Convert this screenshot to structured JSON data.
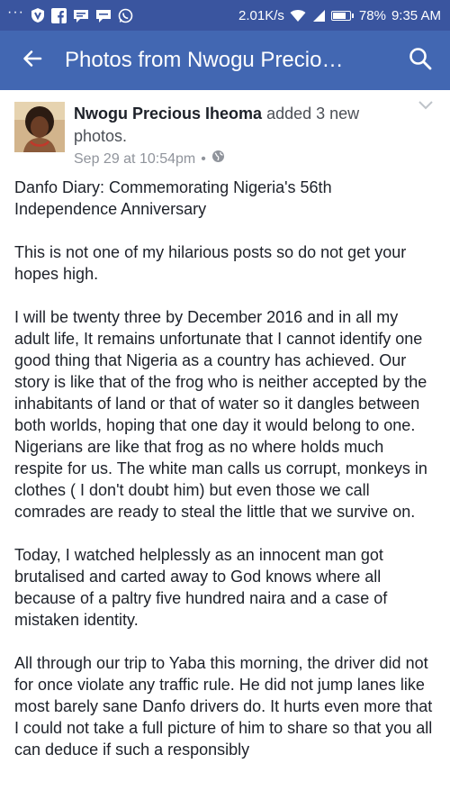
{
  "status_bar": {
    "network_speed": "2.01K/s",
    "battery_percent": "78%",
    "battery_level": 0.78,
    "time": "9:35 AM"
  },
  "app_bar": {
    "title": "Photos from Nwogu Precio…",
    "back_icon": "back-arrow-icon",
    "search_icon": "search-icon"
  },
  "post": {
    "author": "Nwogu Precious Iheoma",
    "action": "added 3 new photos.",
    "timestamp": "Sep 29 at 10:54pm",
    "separator": "•",
    "privacy_icon": "globe-icon",
    "paragraphs": [
      "Danfo Diary: Commemorating Nigeria's 56th Independence Anniversary",
      "This is not one of my hilarious posts so do not get your hopes high.",
      "I will be twenty three by December 2016 and in all my adult life, It remains unfortunate that I cannot identify one good thing that Nigeria as a country has achieved. Our story is like that of the frog who is neither accepted by the inhabitants of land or that of water so it dangles between both worlds, hoping that one day it would belong to one. Nigerians are like that frog as no where holds much respite for us. The white man calls us corrupt, monkeys in clothes ( I don't doubt him) but even those we call comrades are ready to steal the little that we survive on.",
      "Today, I watched helplessly as an innocent man got brutalised and carted away to God knows where all because of a paltry five hundred naira and a case of mistaken identity.",
      "All through our trip to Yaba this morning, the driver did not for once violate any traffic rule. He did not jump lanes like most barely sane Danfo drivers do. It hurts even more that I could not take a full picture of him to share so that you all can deduce if such a responsibly"
    ]
  }
}
